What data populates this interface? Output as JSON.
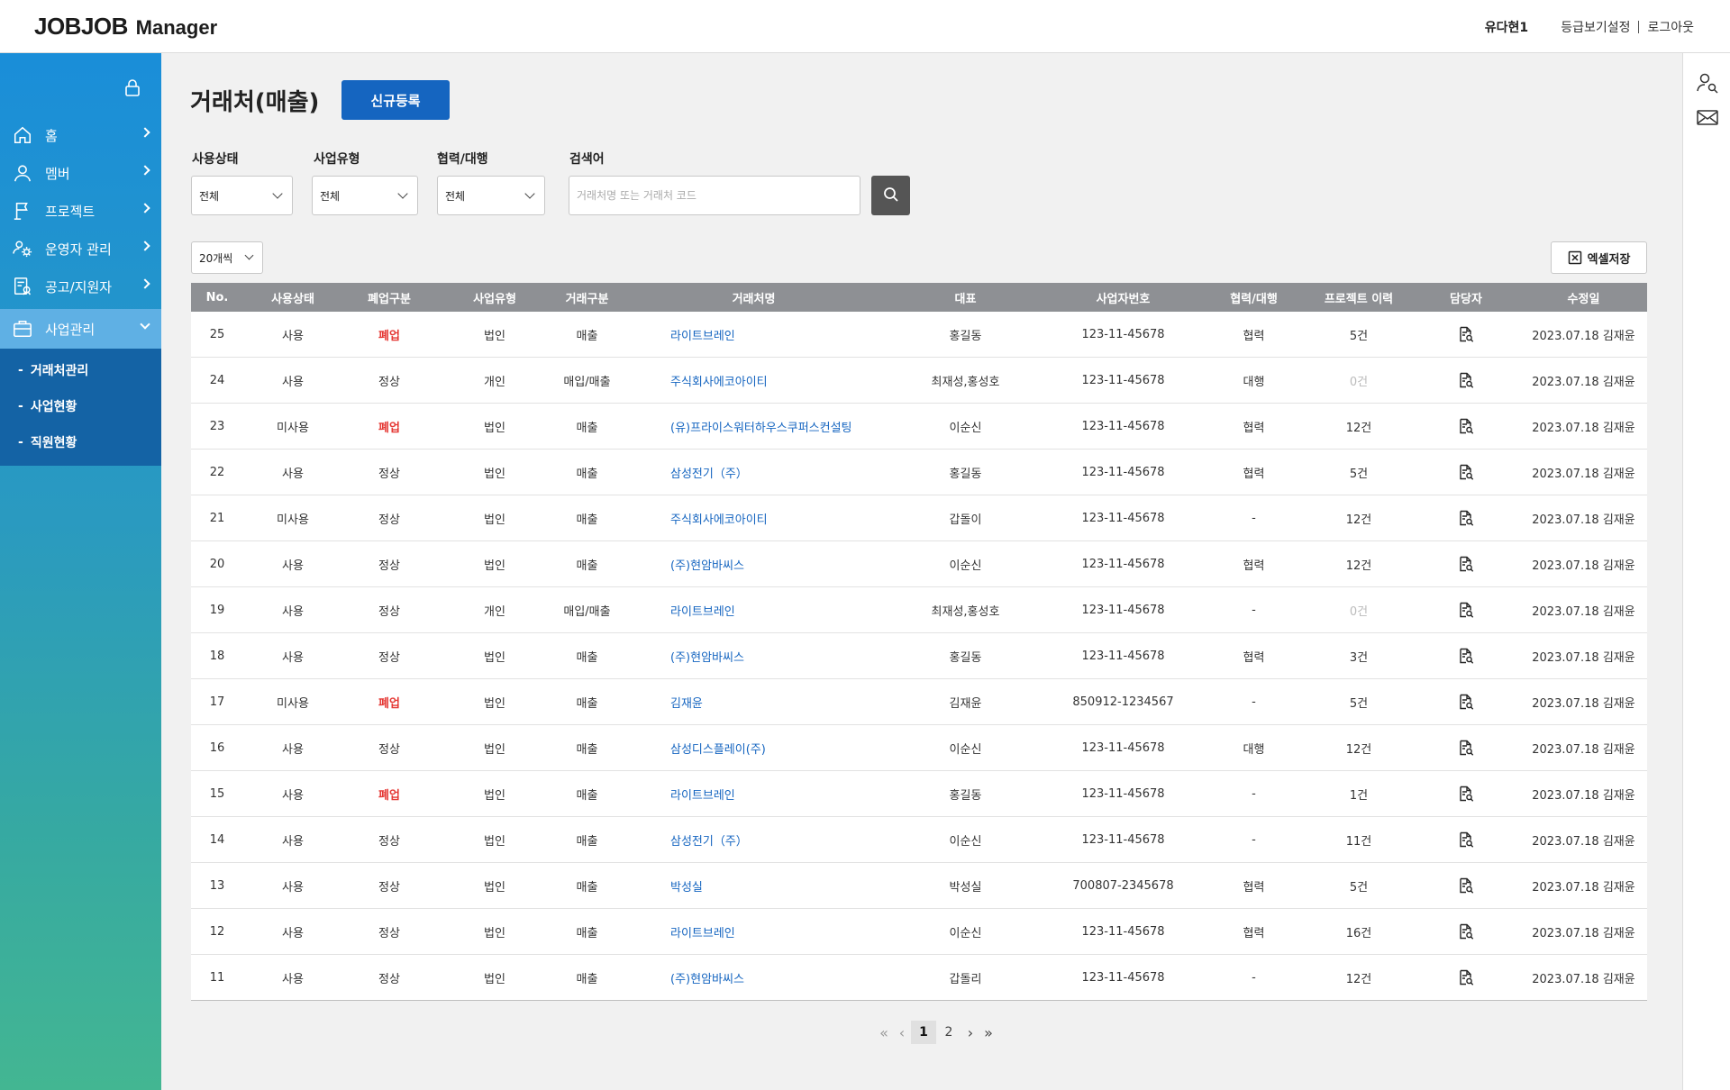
{
  "header": {
    "logo_main": "JOBJOB",
    "logo_sub": "Manager",
    "user_name": "유다현1",
    "grade_setting": "등급보기설정",
    "logout": "로그아웃"
  },
  "sidebar": {
    "items": [
      {
        "label": "홈",
        "icon": "home-icon"
      },
      {
        "label": "멤버",
        "icon": "user-icon"
      },
      {
        "label": "프로젝트",
        "icon": "flag-icon"
      },
      {
        "label": "운영자 관리",
        "icon": "admin-gear-icon"
      },
      {
        "label": "공고/지원자",
        "icon": "notice-icon"
      },
      {
        "label": "사업관리",
        "icon": "briefcase-icon"
      }
    ],
    "sub_items": [
      {
        "label": "거래처관리"
      },
      {
        "label": "사업현황"
      },
      {
        "label": "직원현황"
      }
    ]
  },
  "page": {
    "title": "거래처(매출)",
    "new_button": "신규등록"
  },
  "filters": {
    "status_label": "사용상태",
    "status_value": "전체",
    "biz_type_label": "사업유형",
    "biz_type_value": "전체",
    "partner_label": "협력/대행",
    "partner_value": "전체",
    "search_label": "검색어",
    "search_placeholder": "거래처명 또는 거래처 코드"
  },
  "toolbar": {
    "per_page": "20개씩",
    "excel": "엑셀저장"
  },
  "table": {
    "columns": [
      "No.",
      "사용상태",
      "폐업구분",
      "사업유형",
      "거래구분",
      "거래처명",
      "대표",
      "사업자번호",
      "협력/대행",
      "프로젝트 이력",
      "담당자",
      "수정일"
    ],
    "rows": [
      [
        "25",
        "사용",
        "폐업",
        "법인",
        "매출",
        "라이트브레인",
        "홍길동",
        "123-11-45678",
        "협력",
        "5건",
        "",
        "2023.07.18 김재윤"
      ],
      [
        "24",
        "사용",
        "정상",
        "개인",
        "매입/매출",
        "주식회사에코아이티",
        "최재성,홍성호",
        "123-11-45678",
        "대행",
        "0건",
        "",
        "2023.07.18 김재윤"
      ],
      [
        "23",
        "미사용",
        "폐업",
        "법인",
        "매출",
        "(유)프라이스워터하우스쿠퍼스컨설팅",
        "이순신",
        "123-11-45678",
        "협력",
        "12건",
        "",
        "2023.07.18 김재윤"
      ],
      [
        "22",
        "사용",
        "정상",
        "법인",
        "매출",
        "삼성전기（주）",
        "홍길동",
        "123-11-45678",
        "협력",
        "5건",
        "",
        "2023.07.18 김재윤"
      ],
      [
        "21",
        "미사용",
        "정상",
        "법인",
        "매출",
        "주식회사에코아이티",
        "갑돌이",
        "123-11-45678",
        "-",
        "12건",
        "",
        "2023.07.18 김재윤"
      ],
      [
        "20",
        "사용",
        "정상",
        "법인",
        "매출",
        "(주)현암바씨스",
        "이순신",
        "123-11-45678",
        "협력",
        "12건",
        "",
        "2023.07.18 김재윤"
      ],
      [
        "19",
        "사용",
        "정상",
        "개인",
        "매입/매출",
        "라이트브레인",
        "최재성,홍성호",
        "123-11-45678",
        "-",
        "0건",
        "",
        "2023.07.18 김재윤"
      ],
      [
        "18",
        "사용",
        "정상",
        "법인",
        "매출",
        "(주)현암바씨스",
        "홍길동",
        "123-11-45678",
        "협력",
        "3건",
        "",
        "2023.07.18 김재윤"
      ],
      [
        "17",
        "미사용",
        "폐업",
        "법인",
        "매출",
        "김재윤",
        "김재윤",
        "850912-1234567",
        "-",
        "5건",
        "",
        "2023.07.18 김재윤"
      ],
      [
        "16",
        "사용",
        "정상",
        "법인",
        "매출",
        "삼성디스플레이(주)",
        "이순신",
        "123-11-45678",
        "대행",
        "12건",
        "",
        "2023.07.18 김재윤"
      ],
      [
        "15",
        "사용",
        "폐업",
        "법인",
        "매출",
        "라이트브레인",
        "홍길동",
        "123-11-45678",
        "-",
        "1건",
        "",
        "2023.07.18 김재윤"
      ],
      [
        "14",
        "사용",
        "정상",
        "법인",
        "매출",
        "삼성전기（주）",
        "이순신",
        "123-11-45678",
        "-",
        "11건",
        "",
        "2023.07.18 김재윤"
      ],
      [
        "13",
        "사용",
        "정상",
        "법인",
        "매출",
        "박성실",
        "박성실",
        "700807-2345678",
        "협력",
        "5건",
        "",
        "2023.07.18 김재윤"
      ],
      [
        "12",
        "사용",
        "정상",
        "법인",
        "매출",
        "라이트브레인",
        "이순신",
        "123-11-45678",
        "협력",
        "16건",
        "",
        "2023.07.18 김재윤"
      ],
      [
        "11",
        "사용",
        "정상",
        "법인",
        "매출",
        "(주)현암바씨스",
        "갑돌리",
        "123-11-45678",
        "-",
        "12건",
        "",
        "2023.07.18 김재윤"
      ]
    ]
  },
  "pagination": {
    "pages": [
      "1",
      "2"
    ],
    "current": "1"
  },
  "colors": {
    "primary": "#1565c0",
    "closed_red": "#e53935",
    "header_gray": "#8e9094",
    "sidebar_top": "#1a8ed9",
    "sidebar_bottom": "#43b692"
  }
}
